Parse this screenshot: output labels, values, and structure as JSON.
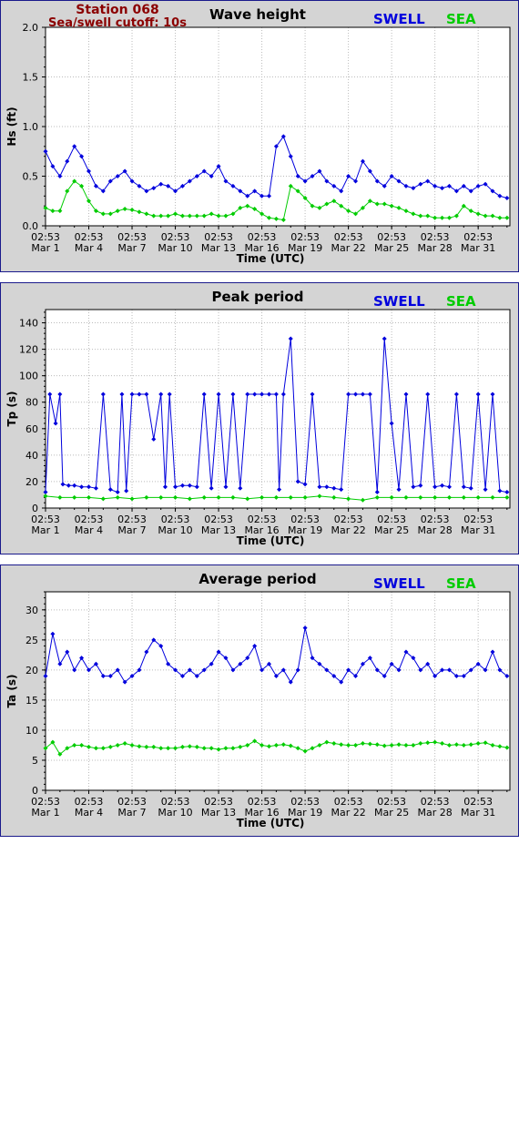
{
  "header": {
    "station": "Station 068",
    "cutoff": "Sea/swell cutoff: 10s"
  },
  "legend": {
    "swell_label": "SWELL",
    "sea_label": "SEA",
    "swell_color": "#0000dd",
    "sea_color": "#00cc00"
  },
  "x_axis": {
    "label": "Time (UTC)",
    "time_label": "02:53",
    "dates": [
      "Mar 1",
      "Mar 4",
      "Mar 7",
      "Mar 10",
      "Mar 13",
      "Mar 16",
      "Mar 19",
      "Mar 22",
      "Mar 25",
      "Mar 28",
      "Mar 31"
    ]
  },
  "chart_data": [
    {
      "type": "line",
      "title": "Wave height",
      "ylabel": "Hs (ft)",
      "ylim": [
        0,
        2.0
      ],
      "yticks": [
        "0.0",
        "0.5",
        "1.0",
        "1.5",
        "2.0"
      ],
      "x_range_days": [
        0,
        32.2
      ],
      "series": [
        {
          "name": "SWELL",
          "x": [
            0,
            0.5,
            1,
            1.5,
            2,
            2.5,
            3,
            3.5,
            4,
            4.5,
            5,
            5.5,
            6,
            6.5,
            7,
            7.5,
            8,
            8.5,
            9,
            9.5,
            10,
            10.5,
            11,
            11.5,
            12,
            12.5,
            13,
            13.5,
            14,
            14.5,
            15,
            15.5,
            16,
            16.5,
            17,
            17.5,
            18,
            18.5,
            19,
            19.5,
            20,
            20.5,
            21,
            21.5,
            22,
            22.5,
            23,
            23.5,
            24,
            24.5,
            25,
            25.5,
            26,
            26.5,
            27,
            27.5,
            28,
            28.5,
            29,
            29.5,
            30,
            30.5,
            31,
            31.5,
            32
          ],
          "y": [
            0.75,
            0.6,
            0.5,
            0.65,
            0.8,
            0.7,
            0.55,
            0.4,
            0.35,
            0.45,
            0.5,
            0.55,
            0.45,
            0.4,
            0.35,
            0.38,
            0.42,
            0.4,
            0.35,
            0.4,
            0.45,
            0.5,
            0.55,
            0.5,
            0.6,
            0.45,
            0.4,
            0.35,
            0.3,
            0.35,
            0.3,
            0.3,
            0.8,
            0.9,
            0.7,
            0.5,
            0.45,
            0.5,
            0.55,
            0.45,
            0.4,
            0.35,
            0.5,
            0.45,
            0.65,
            0.55,
            0.45,
            0.4,
            0.5,
            0.45,
            0.4,
            0.38,
            0.42,
            0.45,
            0.4,
            0.38,
            0.4,
            0.35,
            0.4,
            0.35,
            0.4,
            0.42,
            0.35,
            0.3,
            0.28
          ]
        },
        {
          "name": "SEA",
          "x": [
            0,
            0.5,
            1,
            1.5,
            2,
            2.5,
            3,
            3.5,
            4,
            4.5,
            5,
            5.5,
            6,
            6.5,
            7,
            7.5,
            8,
            8.5,
            9,
            9.5,
            10,
            10.5,
            11,
            11.5,
            12,
            12.5,
            13,
            13.5,
            14,
            14.5,
            15,
            15.5,
            16,
            16.5,
            17,
            17.5,
            18,
            18.5,
            19,
            19.5,
            20,
            20.5,
            21,
            21.5,
            22,
            22.5,
            23,
            23.5,
            24,
            24.5,
            25,
            25.5,
            26,
            26.5,
            27,
            27.5,
            28,
            28.5,
            29,
            29.5,
            30,
            30.5,
            31,
            31.5,
            32
          ],
          "y": [
            0.18,
            0.15,
            0.15,
            0.35,
            0.45,
            0.4,
            0.25,
            0.15,
            0.12,
            0.12,
            0.15,
            0.17,
            0.16,
            0.14,
            0.12,
            0.1,
            0.1,
            0.1,
            0.12,
            0.1,
            0.1,
            0.1,
            0.1,
            0.12,
            0.1,
            0.1,
            0.12,
            0.18,
            0.2,
            0.17,
            0.12,
            0.08,
            0.07,
            0.06,
            0.4,
            0.35,
            0.28,
            0.2,
            0.18,
            0.22,
            0.25,
            0.2,
            0.15,
            0.12,
            0.18,
            0.25,
            0.22,
            0.22,
            0.2,
            0.18,
            0.15,
            0.12,
            0.1,
            0.1,
            0.08,
            0.08,
            0.08,
            0.1,
            0.2,
            0.15,
            0.12,
            0.1,
            0.1,
            0.08,
            0.08
          ]
        }
      ]
    },
    {
      "type": "line",
      "title": "Peak period",
      "ylabel": "Tp (s)",
      "ylim": [
        0,
        150
      ],
      "yticks": [
        "0",
        "20",
        "40",
        "60",
        "80",
        "100",
        "120",
        "140"
      ],
      "x_range_days": [
        0,
        32.2
      ],
      "series": [
        {
          "name": "SWELL",
          "x": [
            0,
            0.3,
            0.7,
            1,
            1.2,
            1.6,
            2,
            2.5,
            3,
            3.5,
            4,
            4.5,
            5,
            5.3,
            5.6,
            6,
            6.5,
            7,
            7.5,
            8,
            8.3,
            8.6,
            9,
            9.5,
            10,
            10.5,
            11,
            11.5,
            12,
            12.5,
            13,
            13.5,
            14,
            14.5,
            15,
            15.5,
            16,
            16.2,
            16.5,
            17,
            17.5,
            18,
            18.5,
            19,
            19.5,
            20,
            20.5,
            21,
            21.5,
            22,
            22.5,
            23,
            23.5,
            24,
            24.5,
            25,
            25.5,
            26,
            26.5,
            27,
            27.5,
            28,
            28.5,
            29,
            29.5,
            30,
            30.5,
            31,
            31.5,
            32
          ],
          "y": [
            12,
            86,
            64,
            86,
            18,
            17,
            17,
            16,
            16,
            15,
            86,
            14,
            12,
            86,
            13,
            86,
            86,
            86,
            52,
            86,
            16,
            86,
            16,
            17,
            17,
            16,
            86,
            15,
            86,
            16,
            86,
            15,
            86,
            86,
            86,
            86,
            86,
            14,
            86,
            128,
            20,
            18,
            86,
            16,
            16,
            15,
            14,
            86,
            86,
            86,
            86,
            12,
            128,
            64,
            14,
            86,
            16,
            17,
            86,
            16,
            17,
            16,
            86,
            16,
            15,
            86,
            14,
            86,
            13,
            12
          ]
        },
        {
          "name": "SEA",
          "x": [
            0,
            1,
            2,
            3,
            4,
            5,
            6,
            7,
            8,
            9,
            10,
            11,
            12,
            13,
            14,
            15,
            16,
            17,
            18,
            19,
            20,
            21,
            22,
            23,
            24,
            25,
            26,
            27,
            28,
            29,
            30,
            31,
            32
          ],
          "y": [
            9,
            8,
            8,
            8,
            7,
            8,
            7,
            8,
            8,
            8,
            7,
            8,
            8,
            8,
            7,
            8,
            8,
            8,
            8,
            9,
            8,
            7,
            6,
            8,
            8,
            8,
            8,
            8,
            8,
            8,
            8,
            8,
            8
          ]
        }
      ]
    },
    {
      "type": "line",
      "title": "Average period",
      "ylabel": "Ta (s)",
      "ylim": [
        0,
        33
      ],
      "yticks": [
        "0",
        "5",
        "10",
        "15",
        "20",
        "25",
        "30"
      ],
      "x_range_days": [
        0,
        32.2
      ],
      "series": [
        {
          "name": "SWELL",
          "x": [
            0,
            0.5,
            1,
            1.5,
            2,
            2.5,
            3,
            3.5,
            4,
            4.5,
            5,
            5.5,
            6,
            6.5,
            7,
            7.5,
            8,
            8.5,
            9,
            9.5,
            10,
            10.5,
            11,
            11.5,
            12,
            12.5,
            13,
            13.5,
            14,
            14.5,
            15,
            15.5,
            16,
            16.5,
            17,
            17.5,
            18,
            18.5,
            19,
            19.5,
            20,
            20.5,
            21,
            21.5,
            22,
            22.5,
            23,
            23.5,
            24,
            24.5,
            25,
            25.5,
            26,
            26.5,
            27,
            27.5,
            28,
            28.5,
            29,
            29.5,
            30,
            30.5,
            31,
            31.5,
            32
          ],
          "y": [
            19,
            26,
            21,
            23,
            20,
            22,
            20,
            21,
            19,
            19,
            20,
            18,
            19,
            20,
            23,
            25,
            24,
            21,
            20,
            19,
            20,
            19,
            20,
            21,
            23,
            22,
            20,
            21,
            22,
            24,
            20,
            21,
            19,
            20,
            18,
            20,
            27,
            22,
            21,
            20,
            19,
            18,
            20,
            19,
            21,
            22,
            20,
            19,
            21,
            20,
            23,
            22,
            20,
            21,
            19,
            20,
            20,
            19,
            19,
            20,
            21,
            20,
            23,
            20,
            19
          ]
        },
        {
          "name": "SEA",
          "x": [
            0,
            0.5,
            1,
            1.5,
            2,
            2.5,
            3,
            3.5,
            4,
            4.5,
            5,
            5.5,
            6,
            6.5,
            7,
            7.5,
            8,
            8.5,
            9,
            9.5,
            10,
            10.5,
            11,
            11.5,
            12,
            12.5,
            13,
            13.5,
            14,
            14.5,
            15,
            15.5,
            16,
            16.5,
            17,
            17.5,
            18,
            18.5,
            19,
            19.5,
            20,
            20.5,
            21,
            21.5,
            22,
            22.5,
            23,
            23.5,
            24,
            24.5,
            25,
            25.5,
            26,
            26.5,
            27,
            27.5,
            28,
            28.5,
            29,
            29.5,
            30,
            30.5,
            31,
            31.5,
            32
          ],
          "y": [
            7,
            8,
            6,
            7,
            7.5,
            7.5,
            7.2,
            7,
            7,
            7.2,
            7.5,
            7.8,
            7.5,
            7.3,
            7.2,
            7.2,
            7,
            7,
            7,
            7.2,
            7.3,
            7.2,
            7,
            7,
            6.8,
            7,
            7,
            7.2,
            7.5,
            8.2,
            7.5,
            7.3,
            7.5,
            7.6,
            7.4,
            7,
            6.5,
            7,
            7.5,
            8,
            7.8,
            7.6,
            7.5,
            7.5,
            7.8,
            7.7,
            7.6,
            7.4,
            7.5,
            7.6,
            7.5,
            7.5,
            7.8,
            7.9,
            8,
            7.8,
            7.5,
            7.6,
            7.5,
            7.6,
            7.8,
            7.9,
            7.5,
            7.3,
            7.1
          ]
        }
      ]
    }
  ]
}
